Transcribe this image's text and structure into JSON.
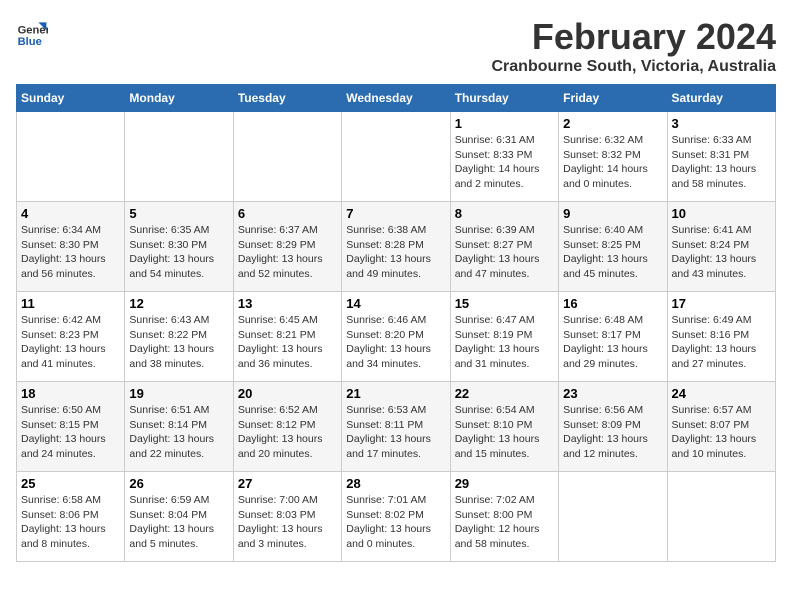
{
  "header": {
    "logo_line1": "General",
    "logo_line2": "Blue",
    "title": "February 2024",
    "subtitle": "Cranbourne South, Victoria, Australia"
  },
  "calendar": {
    "headers": [
      "Sunday",
      "Monday",
      "Tuesday",
      "Wednesday",
      "Thursday",
      "Friday",
      "Saturday"
    ],
    "weeks": [
      [
        {
          "day": "",
          "info": ""
        },
        {
          "day": "",
          "info": ""
        },
        {
          "day": "",
          "info": ""
        },
        {
          "day": "",
          "info": ""
        },
        {
          "day": "1",
          "info": "Sunrise: 6:31 AM\nSunset: 8:33 PM\nDaylight: 14 hours\nand 2 minutes."
        },
        {
          "day": "2",
          "info": "Sunrise: 6:32 AM\nSunset: 8:32 PM\nDaylight: 14 hours\nand 0 minutes."
        },
        {
          "day": "3",
          "info": "Sunrise: 6:33 AM\nSunset: 8:31 PM\nDaylight: 13 hours\nand 58 minutes."
        }
      ],
      [
        {
          "day": "4",
          "info": "Sunrise: 6:34 AM\nSunset: 8:30 PM\nDaylight: 13 hours\nand 56 minutes."
        },
        {
          "day": "5",
          "info": "Sunrise: 6:35 AM\nSunset: 8:30 PM\nDaylight: 13 hours\nand 54 minutes."
        },
        {
          "day": "6",
          "info": "Sunrise: 6:37 AM\nSunset: 8:29 PM\nDaylight: 13 hours\nand 52 minutes."
        },
        {
          "day": "7",
          "info": "Sunrise: 6:38 AM\nSunset: 8:28 PM\nDaylight: 13 hours\nand 49 minutes."
        },
        {
          "day": "8",
          "info": "Sunrise: 6:39 AM\nSunset: 8:27 PM\nDaylight: 13 hours\nand 47 minutes."
        },
        {
          "day": "9",
          "info": "Sunrise: 6:40 AM\nSunset: 8:25 PM\nDaylight: 13 hours\nand 45 minutes."
        },
        {
          "day": "10",
          "info": "Sunrise: 6:41 AM\nSunset: 8:24 PM\nDaylight: 13 hours\nand 43 minutes."
        }
      ],
      [
        {
          "day": "11",
          "info": "Sunrise: 6:42 AM\nSunset: 8:23 PM\nDaylight: 13 hours\nand 41 minutes."
        },
        {
          "day": "12",
          "info": "Sunrise: 6:43 AM\nSunset: 8:22 PM\nDaylight: 13 hours\nand 38 minutes."
        },
        {
          "day": "13",
          "info": "Sunrise: 6:45 AM\nSunset: 8:21 PM\nDaylight: 13 hours\nand 36 minutes."
        },
        {
          "day": "14",
          "info": "Sunrise: 6:46 AM\nSunset: 8:20 PM\nDaylight: 13 hours\nand 34 minutes."
        },
        {
          "day": "15",
          "info": "Sunrise: 6:47 AM\nSunset: 8:19 PM\nDaylight: 13 hours\nand 31 minutes."
        },
        {
          "day": "16",
          "info": "Sunrise: 6:48 AM\nSunset: 8:17 PM\nDaylight: 13 hours\nand 29 minutes."
        },
        {
          "day": "17",
          "info": "Sunrise: 6:49 AM\nSunset: 8:16 PM\nDaylight: 13 hours\nand 27 minutes."
        }
      ],
      [
        {
          "day": "18",
          "info": "Sunrise: 6:50 AM\nSunset: 8:15 PM\nDaylight: 13 hours\nand 24 minutes."
        },
        {
          "day": "19",
          "info": "Sunrise: 6:51 AM\nSunset: 8:14 PM\nDaylight: 13 hours\nand 22 minutes."
        },
        {
          "day": "20",
          "info": "Sunrise: 6:52 AM\nSunset: 8:12 PM\nDaylight: 13 hours\nand 20 minutes."
        },
        {
          "day": "21",
          "info": "Sunrise: 6:53 AM\nSunset: 8:11 PM\nDaylight: 13 hours\nand 17 minutes."
        },
        {
          "day": "22",
          "info": "Sunrise: 6:54 AM\nSunset: 8:10 PM\nDaylight: 13 hours\nand 15 minutes."
        },
        {
          "day": "23",
          "info": "Sunrise: 6:56 AM\nSunset: 8:09 PM\nDaylight: 13 hours\nand 12 minutes."
        },
        {
          "day": "24",
          "info": "Sunrise: 6:57 AM\nSunset: 8:07 PM\nDaylight: 13 hours\nand 10 minutes."
        }
      ],
      [
        {
          "day": "25",
          "info": "Sunrise: 6:58 AM\nSunset: 8:06 PM\nDaylight: 13 hours\nand 8 minutes."
        },
        {
          "day": "26",
          "info": "Sunrise: 6:59 AM\nSunset: 8:04 PM\nDaylight: 13 hours\nand 5 minutes."
        },
        {
          "day": "27",
          "info": "Sunrise: 7:00 AM\nSunset: 8:03 PM\nDaylight: 13 hours\nand 3 minutes."
        },
        {
          "day": "28",
          "info": "Sunrise: 7:01 AM\nSunset: 8:02 PM\nDaylight: 13 hours\nand 0 minutes."
        },
        {
          "day": "29",
          "info": "Sunrise: 7:02 AM\nSunset: 8:00 PM\nDaylight: 12 hours\nand 58 minutes."
        },
        {
          "day": "",
          "info": ""
        },
        {
          "day": "",
          "info": ""
        }
      ]
    ]
  }
}
